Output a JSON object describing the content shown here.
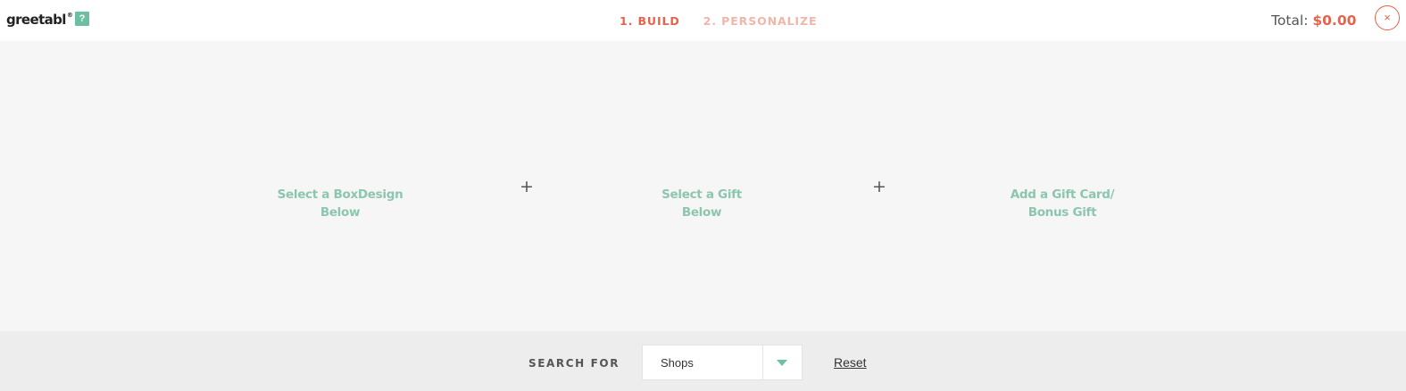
{
  "header": {
    "logo": "greetabl",
    "logo_mark": "®",
    "help_label": "?",
    "steps": [
      {
        "label": "1. BUILD"
      },
      {
        "label": "2. PERSONALIZE"
      }
    ],
    "total_label": "Total:",
    "total_value": "$0.00",
    "close_label": "×"
  },
  "stage": {
    "slots": [
      {
        "line1": "Select a BoxDesign",
        "line2": "Below"
      },
      {
        "line1": "Select a Gift",
        "line2": "Below"
      },
      {
        "line1": "Add a Gift Card/",
        "line2": "Bonus Gift"
      }
    ],
    "plus": "+"
  },
  "footer": {
    "search_label": "SEARCH FOR",
    "select_value": "Shops",
    "reset_label": "Reset"
  },
  "colors": {
    "accent": "#e7624a",
    "accent_muted": "#f2b5a8",
    "green": "#6cbfa0",
    "slot_text": "#8cc6ae"
  },
  "icons": {
    "help": "question-icon",
    "close": "close-icon",
    "dropdown": "chevron-down-icon",
    "plus": "plus-icon"
  }
}
